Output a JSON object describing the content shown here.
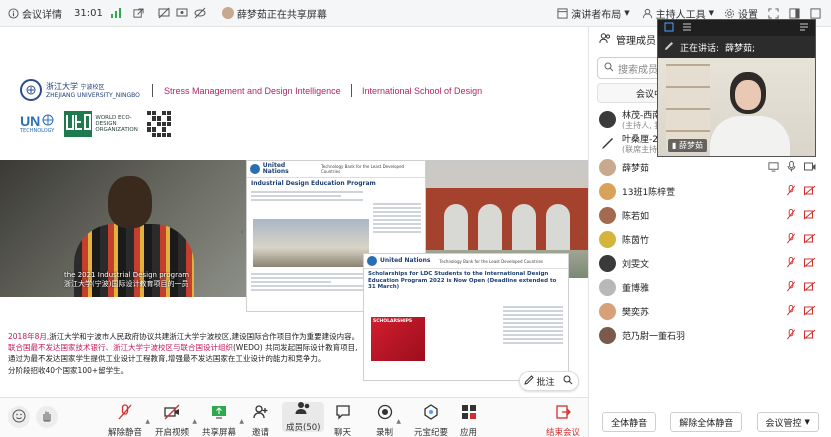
{
  "topbar": {
    "meeting_details": "会议详情",
    "timer": "31:01",
    "sharing_status": "薛梦茹正在共享屏幕",
    "presenter_layout": "演讲者布局",
    "host_tools": "主持人工具",
    "settings": "设置"
  },
  "slide": {
    "zju_name_cn": "浙江大学",
    "zju_sub_cn": "宁波校区",
    "zju_name_en": "ZHEJIANG UNIVERSITY_NINGBO",
    "header_link1": "Stress Management and Design Intelligence",
    "header_link2": "International School of Design",
    "un_logo_top": "UN",
    "un_logo_bottom": "TECHNOLOGY",
    "weo_text": "WORLD ECO-DESIGN ORGANIZATION",
    "video_caption_line1": "the 2021 Industrial Design program",
    "video_caption_line2": "浙江大学(宁波)国际设计教育项目的一员",
    "panel1_org": "United Nations",
    "panel1_title": "Technology Bank for the Least Developed Countries",
    "panel1_heading": "Industrial Design Education Program",
    "panel2_org": "United Nations",
    "panel2_title": "Technology Bank for the Least Developed Countries",
    "panel2_heading": "Scholarships for LDC Students to the International Design Education Program 2022 is Now Open (Deadline extended to 31 March)",
    "poster_text": "SCHOLARSHIPS",
    "para_date": "2018年8月,",
    "para_1": "浙江大学和宁波市人民政府协议共建浙江大学宁波校区,建设国际合作项目作为重要建设内容。",
    "para_2_red": "联合国最不发达国家技术银行、浙江大学宁波校区与联合国设计组织",
    "para_2_rest": "(WEDO) 共同发起国际设计教育项目,",
    "para_3": "通过为最不发达国家学生提供工业设计工程教育,增强最不发达国家在工业设计的能力和竞争力。",
    "para_4": "分阶段招收40个国家100+留学生。",
    "annotate_label": "批注"
  },
  "panel": {
    "title": "管理成员",
    "search_placeholder": "搜索成员",
    "tab_label": "会议中",
    "participants": [
      {
        "name": "林茂-西南交",
        "sub": "(主持人, 我)",
        "color": "#3b3b3b"
      },
      {
        "name": "叶桑厘-2022",
        "sub": "(联席主持人)",
        "color": "#4a6b8a"
      },
      {
        "name": "薛梦茹",
        "sub": "",
        "color": "#c9a890"
      },
      {
        "name": "13班1陈梓萱",
        "sub": "",
        "color": "#d7a35a"
      },
      {
        "name": "陈若如",
        "sub": "",
        "color": "#a26a4f"
      },
      {
        "name": "陈茵竹",
        "sub": "",
        "color": "#d4b43a"
      },
      {
        "name": "刘雯文",
        "sub": "",
        "color": "#3a3a3a"
      },
      {
        "name": "董博雅",
        "sub": "",
        "color": "#b8b8b8"
      },
      {
        "name": "樊奕苏",
        "sub": "",
        "color": "#d6a07a"
      },
      {
        "name": "范乃尉一董石羽",
        "sub": "",
        "color": "#7a5a4a"
      }
    ],
    "footer": {
      "mute_all": "全体静音",
      "unmute_all": "解除全体静音",
      "meeting_control": "会议管控"
    }
  },
  "speaker": {
    "speaking_label": "正在讲话:",
    "speaking_name": "薛梦茹;",
    "video_name": "薛梦茹"
  },
  "toolbar": {
    "unmute": "解除静音",
    "start_video": "开启视频",
    "share_screen": "共享屏幕",
    "invite": "邀请",
    "members": "成员(50)",
    "chat": "聊天",
    "record": "录制",
    "yuanbao": "元宝纪要",
    "apps": "应用",
    "end_meeting": "结束会议"
  },
  "colors": {
    "accent_red": "#d32f2f",
    "header_magenta": "#b0256b",
    "link_red": "#c2185b"
  }
}
